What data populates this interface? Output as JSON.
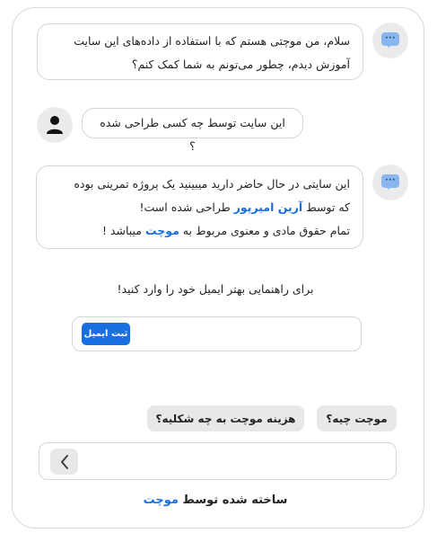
{
  "messages": {
    "bot_greeting": {
      "line1": "سلام، من موچتی هستم که با استفاده از داده‌های این سایت",
      "line2": "آموزش دیدم، چطور می‌تونم به شما کمک کنم؟",
      "icon": "chat-bubble-dots-icon"
    },
    "user_question": {
      "text": "این سایت توسط چه کسی طراحی شده ؟",
      "icon": "user-avatar-icon"
    },
    "bot_answer": {
      "line1": "این سایتی در حال حاضر دارید میبینید یک پروژه تمرینی بوده",
      "line2_prefix": "که توسط ",
      "line2_link": "آرین امیرپور",
      "line2_suffix": " طراحی شده است!",
      "line3_prefix": "تمام حقوق مادی و معنوی مربوط به ",
      "line3_link": "موچت",
      "line3_suffix": " میباشد !",
      "icon": "chat-bubble-dots-icon"
    }
  },
  "email_prompt": {
    "text": "برای راهنمایی بهتر ایمیل خود را وارد کنید!",
    "input_value": "",
    "input_placeholder": "",
    "button_label": "ثبت ایمیل"
  },
  "suggestions": [
    {
      "label": "موچت چیه؟"
    },
    {
      "label": "هزینه موچت به چه شکلیه؟"
    }
  ],
  "chat_input": {
    "value": "",
    "placeholder": "",
    "send_icon": "chevron-left-icon"
  },
  "footer": {
    "prefix": "ساخته شده توسط ",
    "brand": "موچت"
  },
  "colors": {
    "accent": "#1a6fe0",
    "bot_icon": "#8ab6f0",
    "chip_bg": "#e8e8e8"
  }
}
